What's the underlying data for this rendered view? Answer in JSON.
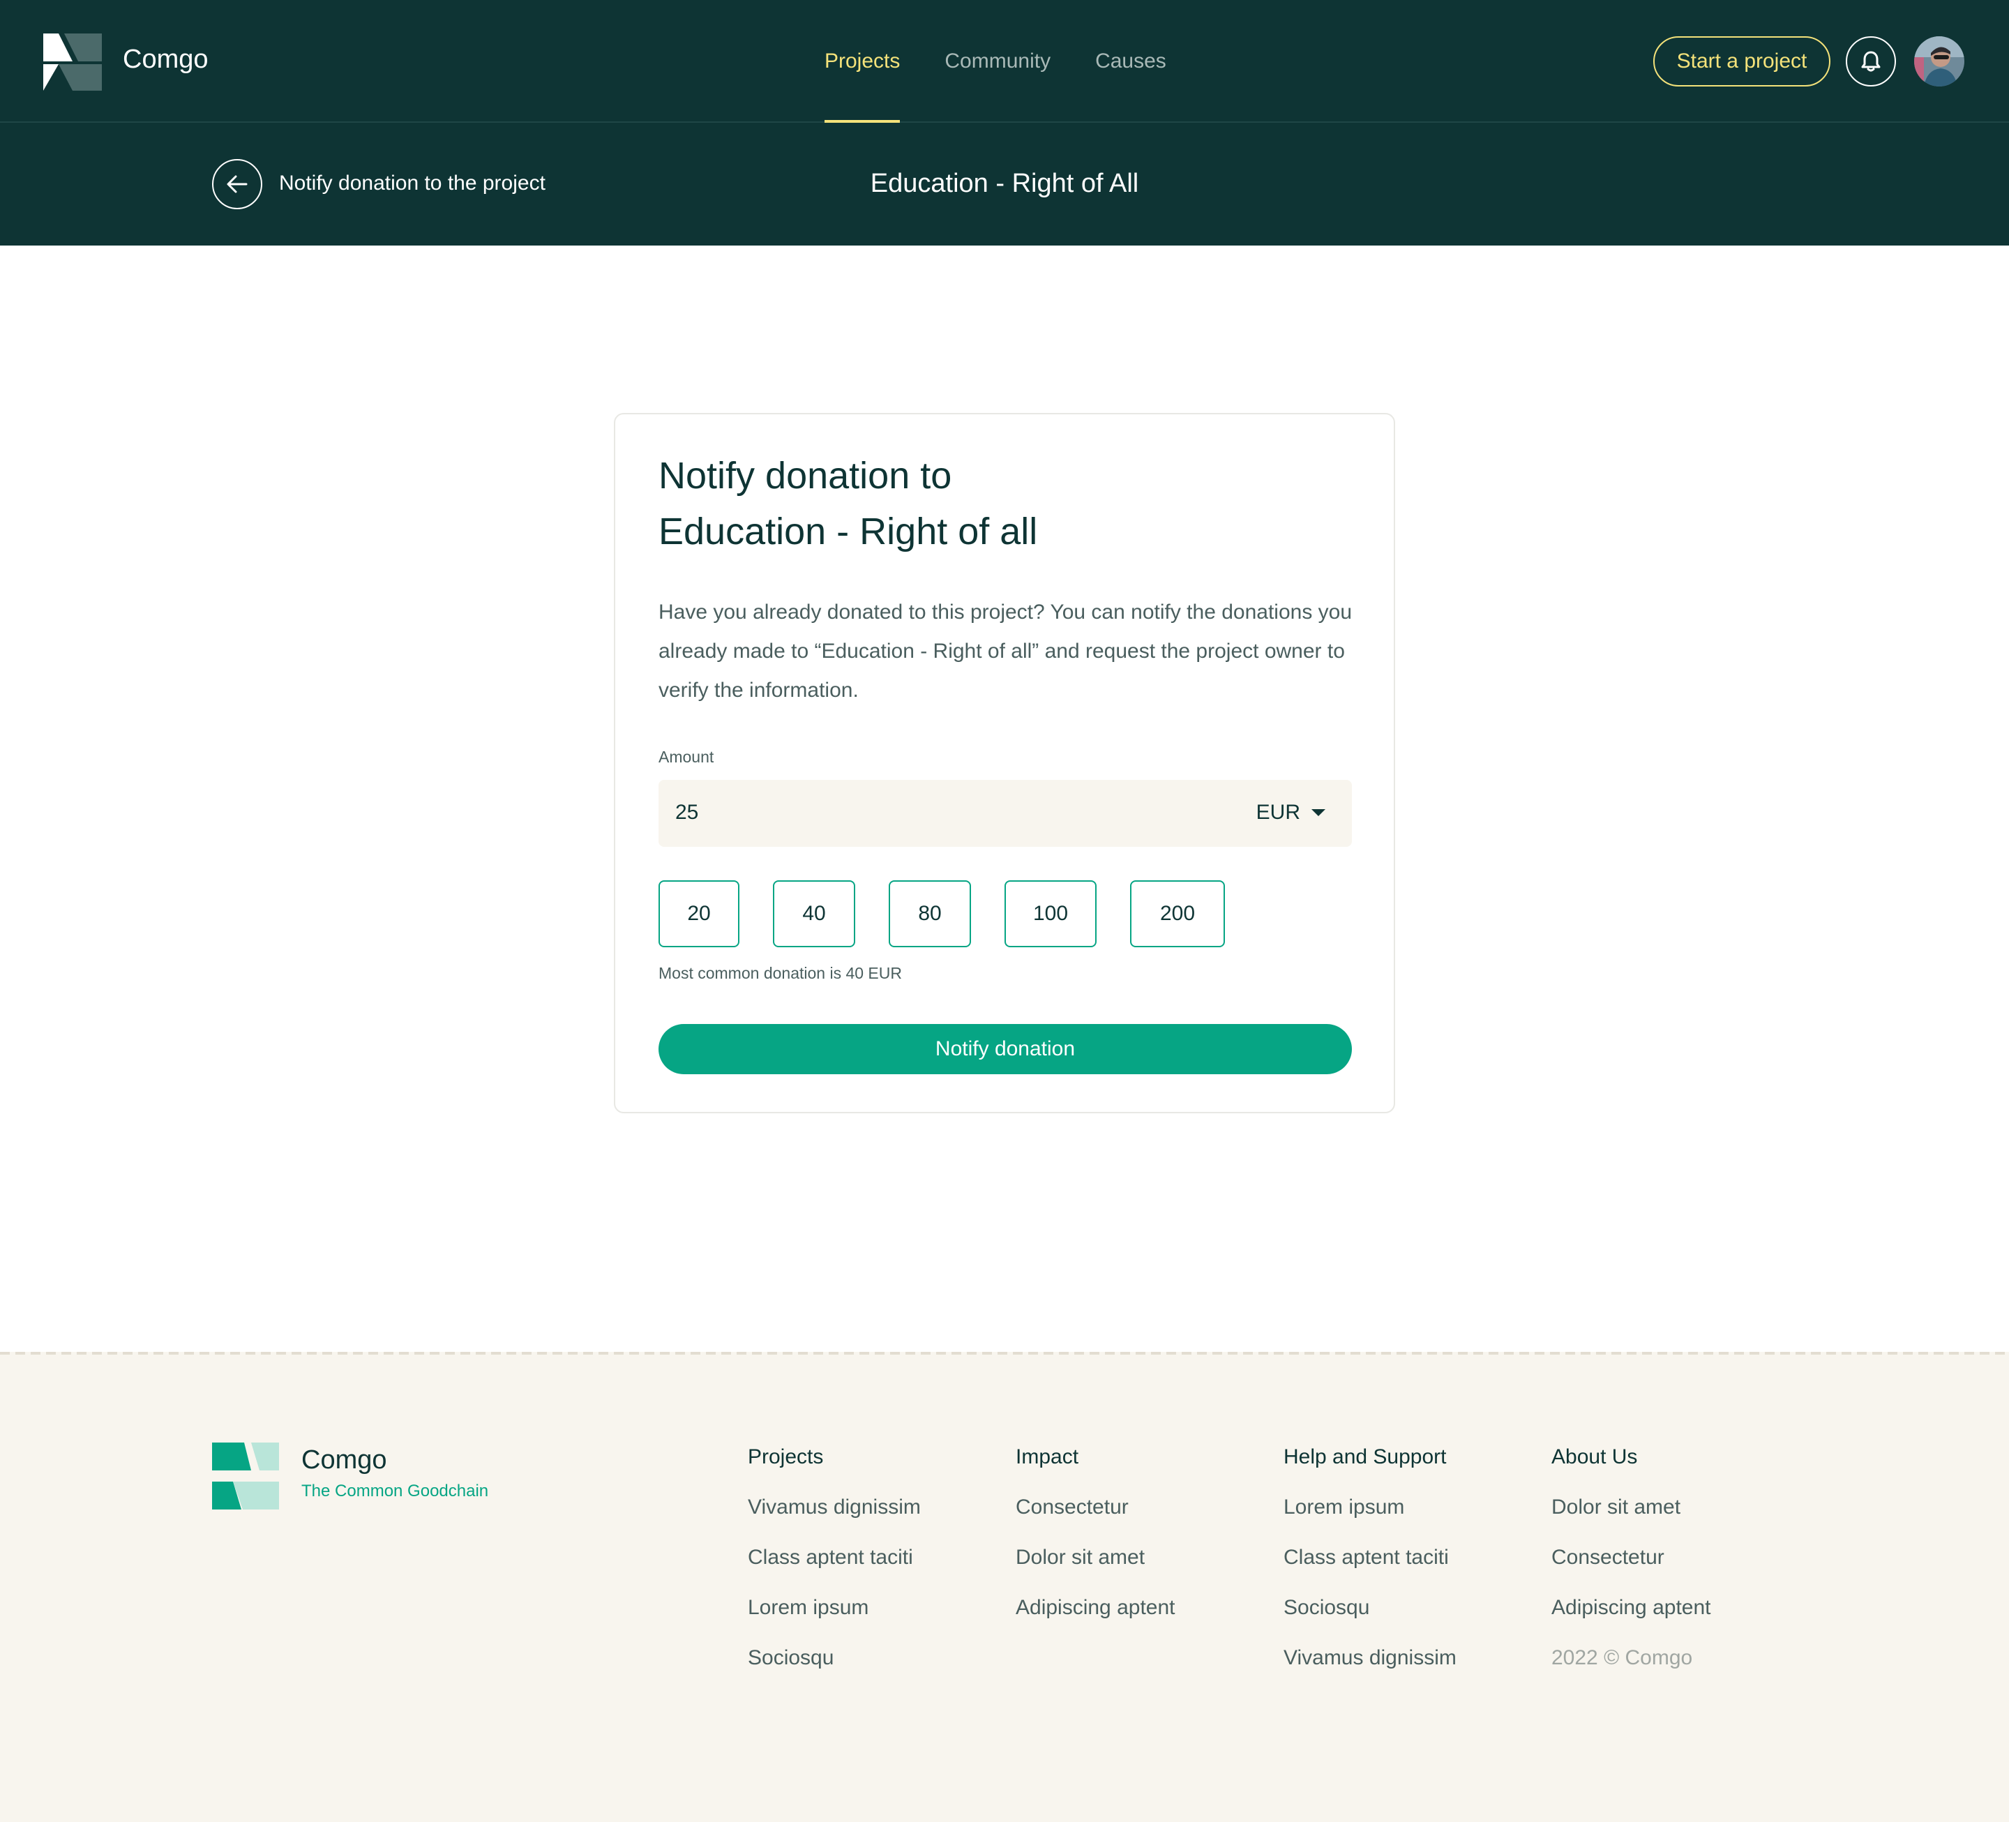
{
  "nav": {
    "brand": "Comgo",
    "links": [
      {
        "label": "Projects",
        "active": true
      },
      {
        "label": "Community",
        "active": false
      },
      {
        "label": "Causes",
        "active": false
      }
    ],
    "cta": "Start a project",
    "icons": {
      "bell": "bell-icon",
      "avatar": "user-avatar"
    }
  },
  "subheader": {
    "back_label": "Notify donation to the project",
    "title": "Education - Right of All"
  },
  "form": {
    "title_line1": "Notify donation to",
    "title_line2": "Education - Right of all",
    "description": "Have you already donated to this project? You can notify the donations you already made to “Education - Right of all” and request the project owner to verify the information.",
    "amount_label": "Amount",
    "amount_value": "25",
    "currency": "EUR",
    "quick_amounts": [
      "20",
      "40",
      "80",
      "100",
      "200"
    ],
    "hint": "Most common donation is 40 EUR",
    "submit": "Notify donation"
  },
  "footer": {
    "brand": "Comgo",
    "tagline": "The Common Goodchain",
    "columns": [
      {
        "heading": "Projects",
        "links": [
          "Vivamus dignissim",
          "Class aptent taciti",
          "Lorem ipsum",
          "Sociosqu"
        ]
      },
      {
        "heading": "Impact",
        "links": [
          "Consectetur",
          "Dolor sit amet",
          "Adipiscing aptent"
        ]
      },
      {
        "heading": "Help and Support",
        "links": [
          "Lorem ipsum",
          "Class aptent taciti",
          "Sociosqu",
          "Vivamus dignissim"
        ]
      },
      {
        "heading": "About Us",
        "links": [
          "Dolor sit amet",
          "Consectetur",
          "Adipiscing aptent"
        ]
      }
    ],
    "copyright": "2022 © Comgo"
  },
  "colors": {
    "dark": "#0e3434",
    "accent_yellow": "#f4e27a",
    "green": "#06a584",
    "cream": "#f8f5ee"
  }
}
